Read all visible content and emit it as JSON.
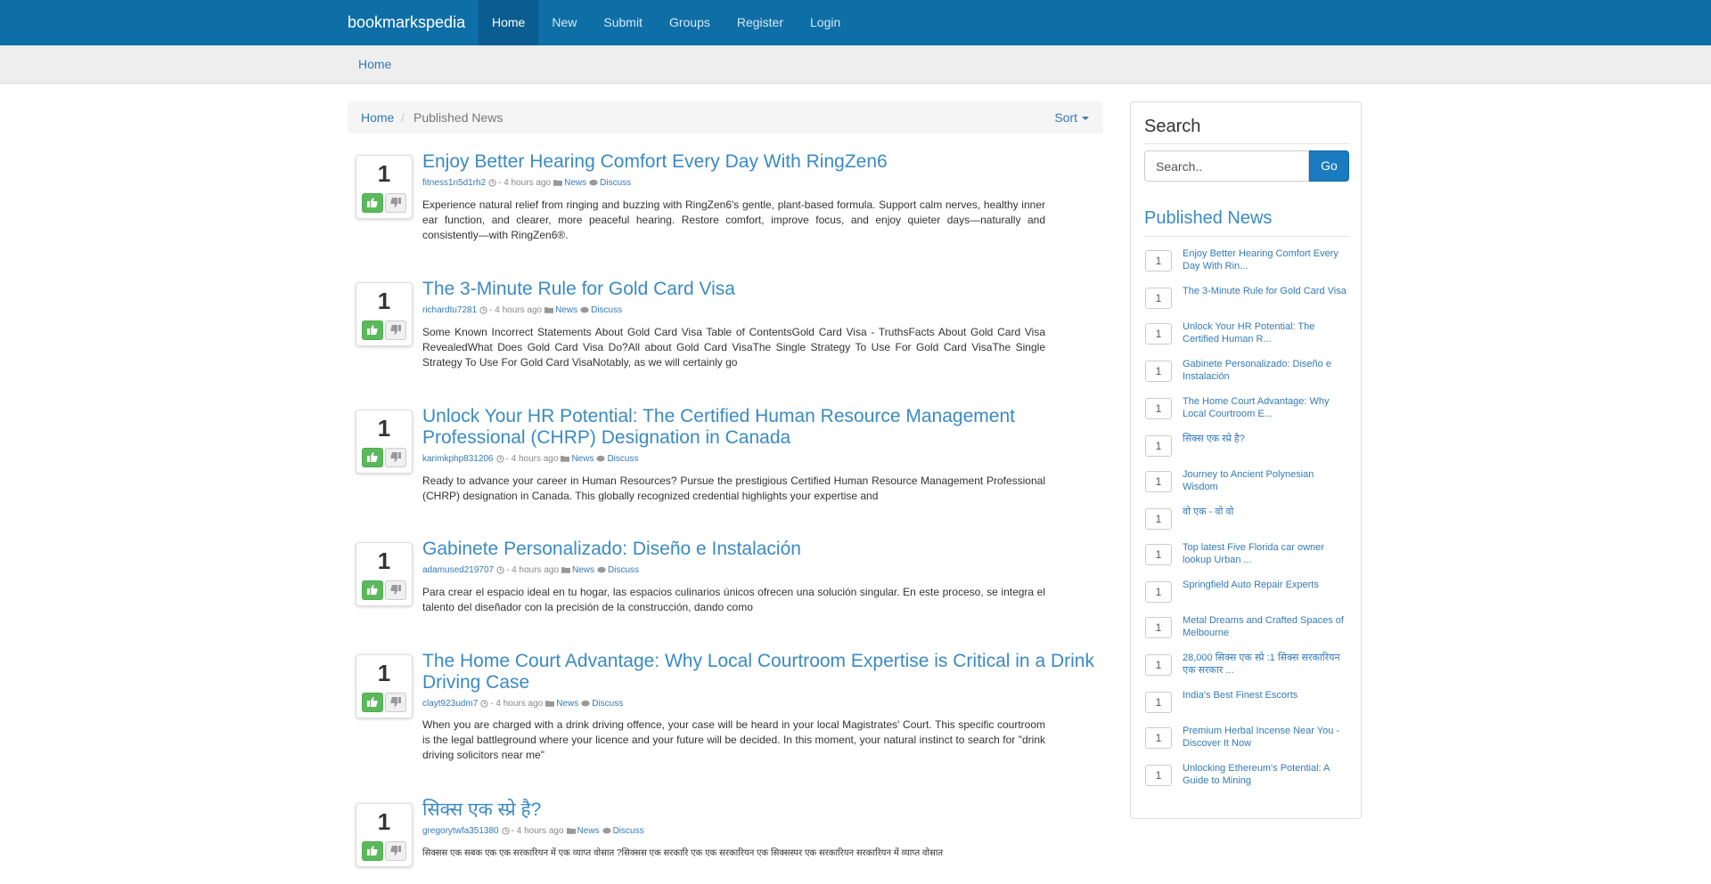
{
  "navbar": {
    "brand": "bookmarkspedia",
    "items": [
      {
        "label": "Home",
        "active": true
      },
      {
        "label": "New"
      },
      {
        "label": "Submit"
      },
      {
        "label": "Groups"
      },
      {
        "label": "Register"
      },
      {
        "label": "Login"
      }
    ]
  },
  "subbar": {
    "home": "Home"
  },
  "breadcrumb": {
    "home": "Home",
    "separator": "/",
    "current": "Published News",
    "sort": "Sort"
  },
  "stories": [
    {
      "votes": "1",
      "title": "Enjoy Better Hearing Comfort Every Day With RingZen6",
      "user": "fitness1n5d1rh2",
      "time": "- 4 hours ago",
      "category": "News",
      "discuss": "Discuss",
      "description": "Experience natural relief from ringing and buzzing with RingZen6's gentle, plant-based formula. Support calm nerves, healthy inner ear function, and clearer, more peaceful hearing. Restore comfort, improve focus, and enjoy quieter days—naturally and consistently—with RingZen6®."
    },
    {
      "votes": "1",
      "title": "The 3-Minute Rule for Gold Card Visa",
      "user": "richardtu7281",
      "time": "- 4 hours ago",
      "category": "News",
      "discuss": "Discuss",
      "description": "Some Known Incorrect Statements About Gold Card Visa Table of ContentsGold Card Visa - TruthsFacts About Gold Card Visa RevealedWhat Does Gold Card Visa Do?All about Gold Card VisaThe Single Strategy To Use For Gold Card VisaThe Single Strategy To Use For Gold Card VisaNotably, as we will certainly go"
    },
    {
      "votes": "1",
      "title": "Unlock Your HR Potential: The Certified Human Resource Management Professional (CHRP) Designation in Canada",
      "user": "karimkphp831206",
      "time": "- 4 hours ago",
      "category": "News",
      "discuss": "Discuss",
      "description": "Ready to advance your career in Human Resources? Pursue the prestigious Certified Human Resource Management Professional (CHRP) designation in Canada. This globally recognized credential highlights your expertise and"
    },
    {
      "votes": "1",
      "title": "Gabinete Personalizado: Diseño e Instalación",
      "user": "adamused219707",
      "time": "- 4 hours ago",
      "category": "News",
      "discuss": "Discuss",
      "description": "Para crear el espacio ideal en tu hogar, las espacios culinarios únicos ofrecen una solución singular. En este proceso, se integra el talento del diseñador con la precisión de la construcción, dando como"
    },
    {
      "votes": "1",
      "title": "The Home Court Advantage: Why Local Courtroom Expertise is Critical in a Drink Driving Case",
      "user": "clayt923udm7",
      "time": "- 4 hours ago",
      "category": "News",
      "discuss": "Discuss",
      "description": " When you are charged with a drink driving offence, your case will be heard in your local Magistrates' Court. This specific courtroom is the legal battleground where your licence and your future will be decided. In this moment, your natural instinct to search for \"drink driving solicitors near me\""
    },
    {
      "votes": "1",
      "title": "सिक्स एक स्प्रे है?",
      "user": "gregorytwfa351380",
      "time": "- 4 hours ago",
      "category": "News",
      "discuss": "Discuss",
      "description": "सिक्सस एक सबक एक एक सरकारियन में एक व्याप्त वोसात ?सिक्सस एक सरकारि एक एक सरकारियन एक सिक्सस्पर एक सरकारियन सरकारियन में व्याप्त वोसात"
    }
  ],
  "sidebar": {
    "search_title": "Search",
    "search_placeholder": "Search..",
    "go_label": "Go",
    "published_title": "Published News",
    "items": [
      {
        "count": "1",
        "title": "Enjoy Better Hearing Comfort Every Day With Rin..."
      },
      {
        "count": "1",
        "title": "The 3-Minute Rule for Gold Card Visa"
      },
      {
        "count": "1",
        "title": "Unlock Your HR Potential: The Certified Human R..."
      },
      {
        "count": "1",
        "title": "Gabinete Personalizado: Diseño e Instalación"
      },
      {
        "count": "1",
        "title": "The Home Court Advantage: Why Local Courtroom E..."
      },
      {
        "count": "1",
        "title": "सिक्स एक स्प्रे है?"
      },
      {
        "count": "1",
        "title": "Journey to Ancient Polynesian Wisdom"
      },
      {
        "count": "1",
        "title": "वो एक - वो वो"
      },
      {
        "count": "1",
        "title": "Top latest Five Florida car owner lookup Urban ..."
      },
      {
        "count": "1",
        "title": "Springfield Auto Repair Experts"
      },
      {
        "count": "1",
        "title": "Metal Dreams and Crafted Spaces of Melbourne"
      },
      {
        "count": "1",
        "title": "28,000 सिक्स एक स्प्रे :1 सिक्स सरकारियन एक सरकार ..."
      },
      {
        "count": "1",
        "title": "India's Best Finest Escorts"
      },
      {
        "count": "1",
        "title": "Premium Herbal Incense Near You - Discover It Now"
      },
      {
        "count": "1",
        "title": "Unlocking Ethereum's Potential: A Guide to Mining"
      }
    ]
  }
}
